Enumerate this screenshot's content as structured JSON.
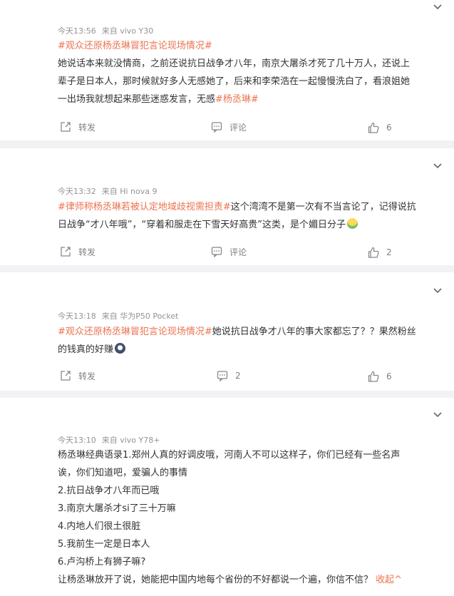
{
  "posts": [
    {
      "time": "今天13:56",
      "source": "来自 vivo Y30",
      "text_lines": [
        [
          {
            "t": "#观众还原杨丞琳冒犯言论现场情况#",
            "tag": true
          }
        ],
        [
          {
            "t": "她说话本来就没情商，之前还说抗日战争才八年，南京大屠杀才死了几十万人，还说上"
          }
        ],
        [
          {
            "t": "辈子是日本人，那时候就好多人无感她了，后来和李荣浩在一起慢慢洗白了，看浪姐她"
          }
        ],
        [
          {
            "t": "一出场我就想起来那些迷惑发言，无感"
          },
          {
            "t": "#杨丞琳#",
            "tag": true
          }
        ]
      ],
      "repost_label": "转发",
      "comment_label": "评论",
      "like_count": "6"
    },
    {
      "time": "今天13:32",
      "source": "来自 Hi nova 9",
      "text_lines": [
        [
          {
            "t": "#律师称杨丞琳若被认定地域歧视需担责#",
            "tag": true
          },
          {
            "t": "这个湾湾不是第一次有不当言论了，记得说抗"
          }
        ],
        [
          {
            "t": "日战争“才八年哦”，“穿着和服走在下雪天好高贵”这类，是个媚日分子"
          }
        ]
      ],
      "repost_label": "转发",
      "comment_label": "评论",
      "like_count": "2"
    },
    {
      "time": "今天13:18",
      "source": "来自 华为P50 Pocket",
      "text_lines": [
        [
          {
            "t": "#观众还原杨丞琳冒犯言论现场情况#",
            "tag": true
          },
          {
            "t": "她说抗日战争才八年的事大家都忘了？？果然粉丝"
          }
        ],
        [
          {
            "t": "的钱真的好赚"
          }
        ]
      ],
      "repost_label": "转发",
      "comment_label": "2",
      "like_count": "6"
    },
    {
      "time": "今天13:10",
      "source": "来自 vivo Y78+",
      "text_lines": [
        [
          {
            "t": "杨丞琳经典语录1.郑州人真的好调皮哦，河南人不可以这样子，你们已经有一些名声"
          }
        ],
        [
          {
            "t": "诶，你们知道吧，爱骗人的事情"
          }
        ],
        [
          {
            "t": "2.抗日战争才八年而已哦"
          }
        ],
        [
          {
            "t": "3.南京大屠杀才si了三十万嘛"
          }
        ],
        [
          {
            "t": "4.内地人们很土很脏"
          }
        ],
        [
          {
            "t": "5.我前生一定是日本人"
          }
        ],
        [
          {
            "t": "6.卢沟桥上有狮子嘛?"
          }
        ],
        [
          {
            "t": "让杨丞琳放开了说，她能把中国内地每个省份的不好都说一个遍，你信不信？"
          }
        ]
      ],
      "collapse_label": "收起^"
    }
  ]
}
